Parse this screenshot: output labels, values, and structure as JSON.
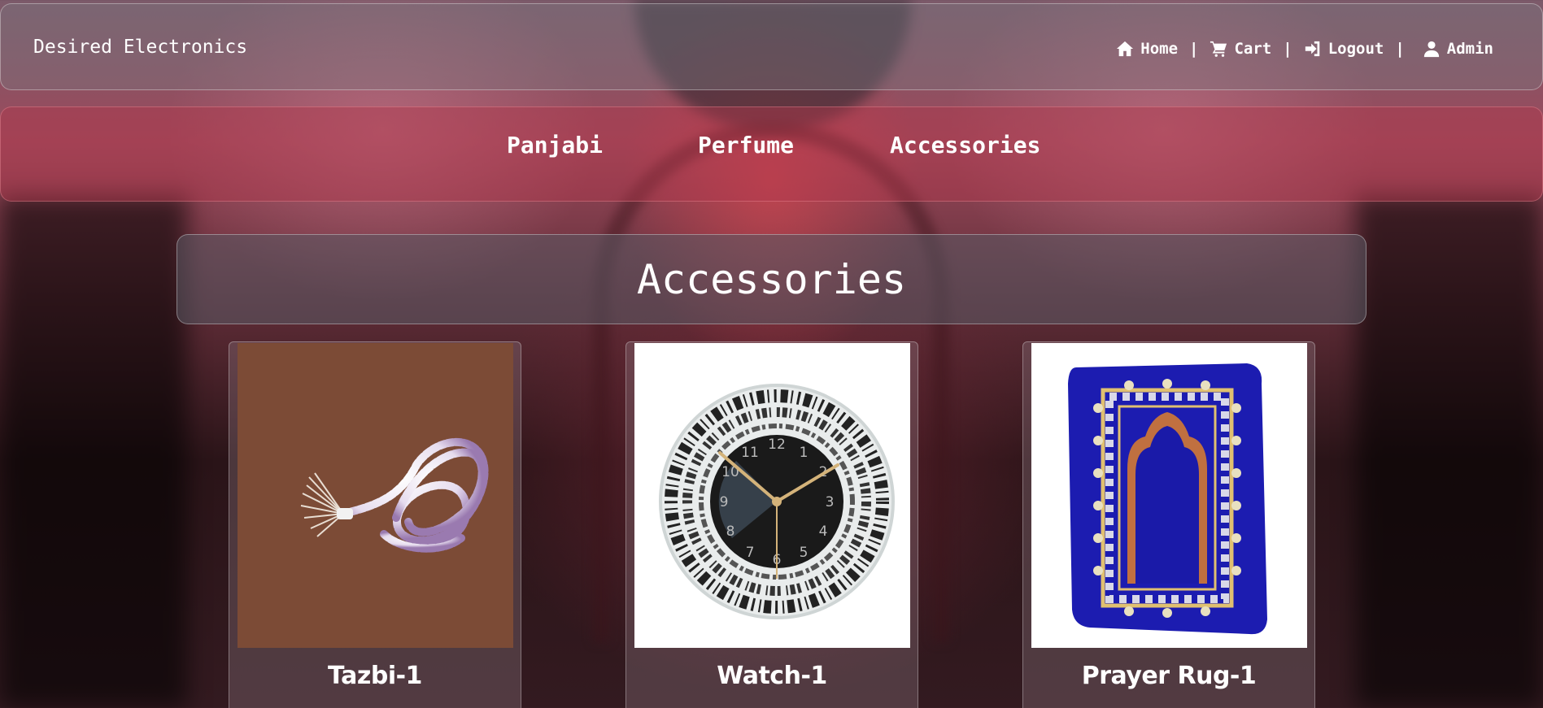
{
  "header": {
    "brand": "Desired Electronics",
    "nav": [
      {
        "label": "Home",
        "icon": "home-icon"
      },
      {
        "label": "Cart",
        "icon": "cart-icon"
      },
      {
        "label": "Logout",
        "icon": "logout-icon"
      },
      {
        "label": "Admin",
        "icon": "user-icon"
      }
    ],
    "separator": "|"
  },
  "categories": [
    "Panjabi",
    "Perfume",
    "Accessories"
  ],
  "page_title": "Accessories",
  "products": [
    {
      "name": "Tazbi-1",
      "image": "prayer-beads-image"
    },
    {
      "name": "Watch-1",
      "image": "calligraphy-wall-clock-image"
    },
    {
      "name": "Prayer Rug-1",
      "image": "prayer-rug-image"
    }
  ],
  "colors": {
    "category_bar": "#af374b",
    "rug_blue": "#1c1cb0",
    "beads_bg": "#7a4a35"
  }
}
